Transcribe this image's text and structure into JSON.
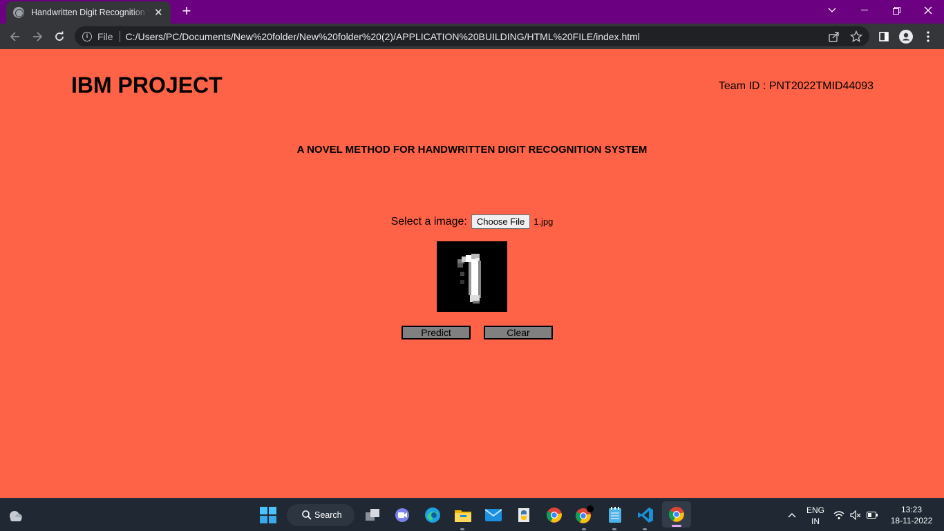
{
  "browser": {
    "tab_title": "Handwritten Digit Recognition Web",
    "url_scheme": "File",
    "url": "C:/Users/PC/Documents/New%20folder/New%20folder%20(2)/APPLICATION%20BUILDING/HTML%20FILE/index.html"
  },
  "page": {
    "brand": "IBM PROJECT",
    "team_id": "Team ID : PNT2022TMID44093",
    "subtitle": "A NOVEL METHOD FOR HANDWRITTEN DIGIT RECOGNITION SYSTEM",
    "select_label": "Select a image:",
    "choose_file_label": "Choose File",
    "file_name": "1.jpg",
    "predict_label": "Predict",
    "clear_label": "Clear",
    "preview_digit": "1"
  },
  "taskbar": {
    "search_label": "Search",
    "language_line1": "ENG",
    "language_line2": "IN",
    "time": "13:23",
    "date": "18-11-2022"
  },
  "colors": {
    "page_background": "#ff6347",
    "titlebar": "#6b0080",
    "toolbar": "#35363a"
  }
}
